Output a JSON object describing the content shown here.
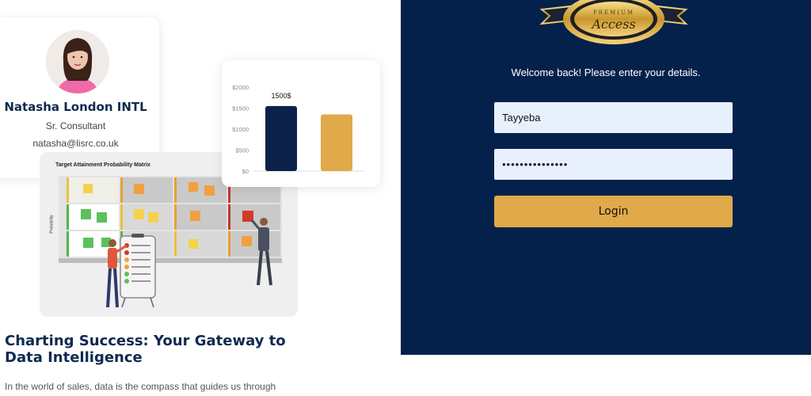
{
  "profile": {
    "name": "Natasha London INTL",
    "role": "Sr. Consultant",
    "email": "natasha@lisrc.co.uk"
  },
  "matrix": {
    "title": "Target Attainment Probability Matrix",
    "y_label": "Probability"
  },
  "chart_data": {
    "type": "bar",
    "categories": [
      "",
      ""
    ],
    "values": [
      1550,
      1350
    ],
    "data_labels": [
      "1500$",
      ""
    ],
    "yticks": [
      "$0",
      "$500",
      "$1000",
      "$1500",
      "$2000"
    ],
    "ylim": [
      0,
      2000
    ],
    "colors": [
      "#0b2149",
      "#e0a949"
    ]
  },
  "article": {
    "title": "Charting Success: Your Gateway to Data Intelligence",
    "body": "In the world of sales, data is the compass that guides us through"
  },
  "login": {
    "logo_top_text": "PREMIUM",
    "logo_script_text": "Access",
    "welcome": "Welcome back! Please enter your details.",
    "username_value": "Tayyeba",
    "password_value": "•••••••••••••••",
    "login_label": "Login"
  },
  "colors": {
    "panel_bg": "#04214b",
    "accent": "#e0a949",
    "input_bg": "#e8f0fe",
    "heading": "#0e2a4f"
  }
}
